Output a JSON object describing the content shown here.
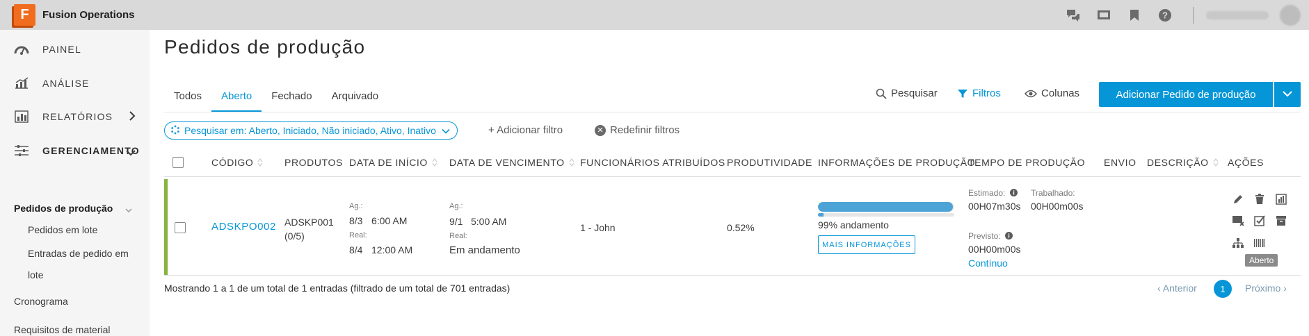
{
  "app": {
    "logo_letter": "F",
    "title": "Fusion Operations",
    "brand_color": "#f06c1e",
    "accent_color": "#0696d7"
  },
  "topbar_icons": [
    "chat-icon",
    "presentation-icon",
    "bookmark-icon",
    "help-icon"
  ],
  "sidebar": {
    "items": [
      {
        "label": "PAINEL",
        "icon": "dashboard-icon"
      },
      {
        "label": "ANÁLISE",
        "icon": "analytics-icon"
      },
      {
        "label": "RELATÓRIOS",
        "icon": "reports-icon"
      },
      {
        "label": "GERENCIAMENTO",
        "icon": "sliders-icon"
      }
    ],
    "active_section": "Pedidos de produção",
    "sub_items": [
      "Pedidos em lote",
      "Entradas de pedido em",
      "lote"
    ],
    "lower_items": [
      "Cronograma",
      "Requisitos de material"
    ]
  },
  "page": {
    "title": "Pedidos de produção"
  },
  "tabs": [
    "Todos",
    "Aberto",
    "Fechado",
    "Arquivado"
  ],
  "toolbar": {
    "search": "Pesquisar",
    "filters": "Filtros",
    "columns": "Colunas",
    "add_button": "Adicionar Pedido de produção"
  },
  "filters": {
    "pill": "Pesquisar em: Aberto, Iniciado, Não iniciado, Ativo, Inativo",
    "add": "+ Adicionar filtro",
    "reset": "Redefinir filtros"
  },
  "table": {
    "headers": [
      "CÓDIGO",
      "PRODUTOS",
      "DATA DE INÍCIO",
      "DATA DE VENCIMENTO",
      "FUNCIONÁRIOS ATRIBUÍDOS",
      "PRODUTIVIDADE",
      "INFORMAÇÕES DE PRODUÇÃO",
      "TEMPO DE PRODUÇÃO",
      "ENVIO",
      "DESCRIÇÃO",
      "AÇÕES"
    ],
    "row": {
      "code": "ADSKPO002",
      "product_line1": "ADSKP001",
      "product_line2": "(0/5)",
      "start_sched_label": "Ag.:",
      "start_sched_date": "8/3",
      "start_sched_time": "6:00 AM",
      "start_real_label": "Real:",
      "start_real_date": "8/4",
      "start_real_time": "12:00 AM",
      "due_sched_label": "Ag.:",
      "due_sched_date": "9/1",
      "due_sched_time": "5:00 AM",
      "due_real_label": "Real:",
      "due_real_value": "Em andamento",
      "employees": "1 - John",
      "productivity": "0.52%",
      "progress_percent": 99,
      "progress_text": "99% andamento",
      "info_button": "MAIS INFORMAÇÕES",
      "estimated_label": "Estimado:",
      "estimated_value": "00H07m30s",
      "worked_label": "Trabalhado:",
      "worked_value": "00H00m00s",
      "forecast_label": "Previsto:",
      "forecast_value": "00H00m00s",
      "continuous": "Contínuo",
      "status_color": "#87b340",
      "actions": [
        "edit-icon",
        "delete-icon",
        "chart-icon",
        "close-order-icon",
        "check-icon",
        "archive-icon",
        "hierarchy-icon",
        "barcode-icon"
      ],
      "tooltip": "Aberto"
    }
  },
  "footer": {
    "summary": "Mostrando 1 a 1 de um total de 1 entradas (filtrado de um total de 701 entradas)",
    "prev": "‹ Anterior",
    "page": "1",
    "next": "Próximo ›"
  }
}
